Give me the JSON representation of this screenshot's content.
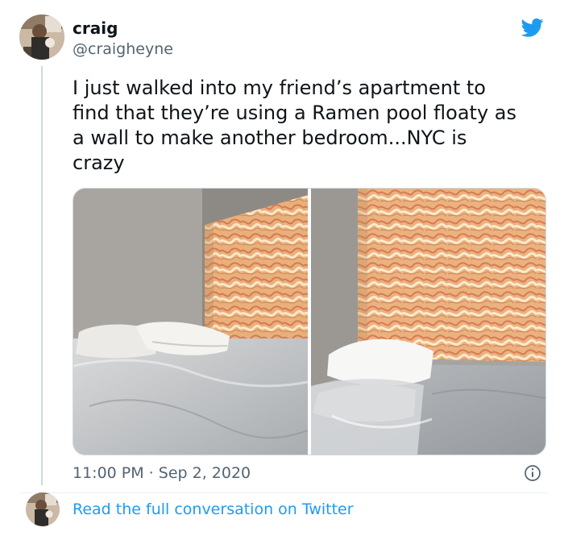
{
  "tweet": {
    "author_name": "craig",
    "author_handle": "@craigheyne",
    "text": "I just walked into my friend’s apartment to\nfind that they’re using a Ramen pool floaty as\na wall to make another bedroom...NYC is\ncrazy",
    "timestamp": "11:00 PM · Sep 2, 2020",
    "footer_link": "Read the full conversation on Twitter"
  },
  "icons": {
    "brand": "twitter-bird-icon",
    "info": "info-icon"
  },
  "colors": {
    "brand_blue": "#1d9bf0",
    "secondary_text": "#536471",
    "primary_text": "#0f1419",
    "divider": "#eff3f4"
  },
  "media": [
    {
      "name": "bedroom-photo-left"
    },
    {
      "name": "bedroom-photo-right"
    }
  ]
}
